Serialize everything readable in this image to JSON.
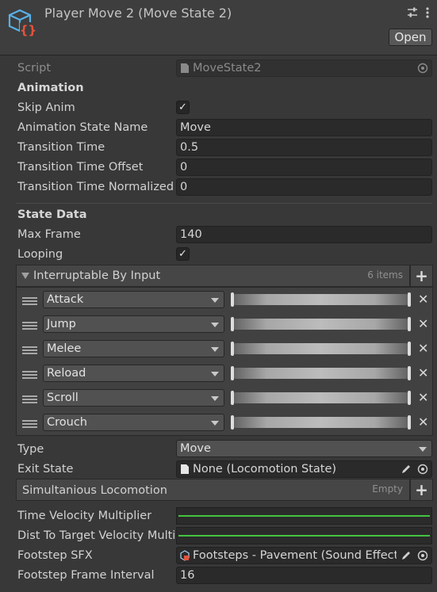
{
  "header": {
    "title": "Player Move 2 (Move State 2)",
    "open_label": "Open"
  },
  "script": {
    "label": "Script",
    "value": "MoveState2"
  },
  "animation": {
    "section_label": "Animation",
    "skip_anim_label": "Skip Anim",
    "skip_anim_checked": true,
    "state_name_label": "Animation State Name",
    "state_name_value": "Move",
    "transition_time_label": "Transition Time",
    "transition_time_value": "0.5",
    "transition_offset_label": "Transition Time Offset",
    "transition_offset_value": "0",
    "transition_normalized_label": "Transition Time Normalized",
    "transition_normalized_value": "0"
  },
  "state_data": {
    "section_label": "State Data",
    "max_frame_label": "Max Frame",
    "max_frame_value": "140",
    "looping_label": "Looping",
    "looping_checked": true
  },
  "interruptable": {
    "label": "Interruptable By Input",
    "count": "6 items",
    "items": [
      {
        "input": "Attack"
      },
      {
        "input": "Jump"
      },
      {
        "input": "Melee"
      },
      {
        "input": "Reload"
      },
      {
        "input": "Scroll"
      },
      {
        "input": "Crouch"
      }
    ]
  },
  "type": {
    "label": "Type",
    "value": "Move"
  },
  "exit_state": {
    "label": "Exit State",
    "value": "None (Locomotion State)"
  },
  "simultaneous": {
    "label": "Simultanious Locomotion",
    "empty_label": "Empty"
  },
  "time_velocity": {
    "label": "Time Velocity Multiplier"
  },
  "dist_velocity": {
    "label": "Dist To Target Velocity Multi"
  },
  "footstep_sfx": {
    "label": "Footstep SFX",
    "value": "Footsteps - Pavement (Sound Effect)"
  },
  "footstep_interval": {
    "label": "Footstep Frame Interval",
    "value": "16"
  },
  "colors": {
    "curve_green": "#43c43f",
    "panel_bg": "#383838",
    "field_bg": "#2a2a2a"
  }
}
